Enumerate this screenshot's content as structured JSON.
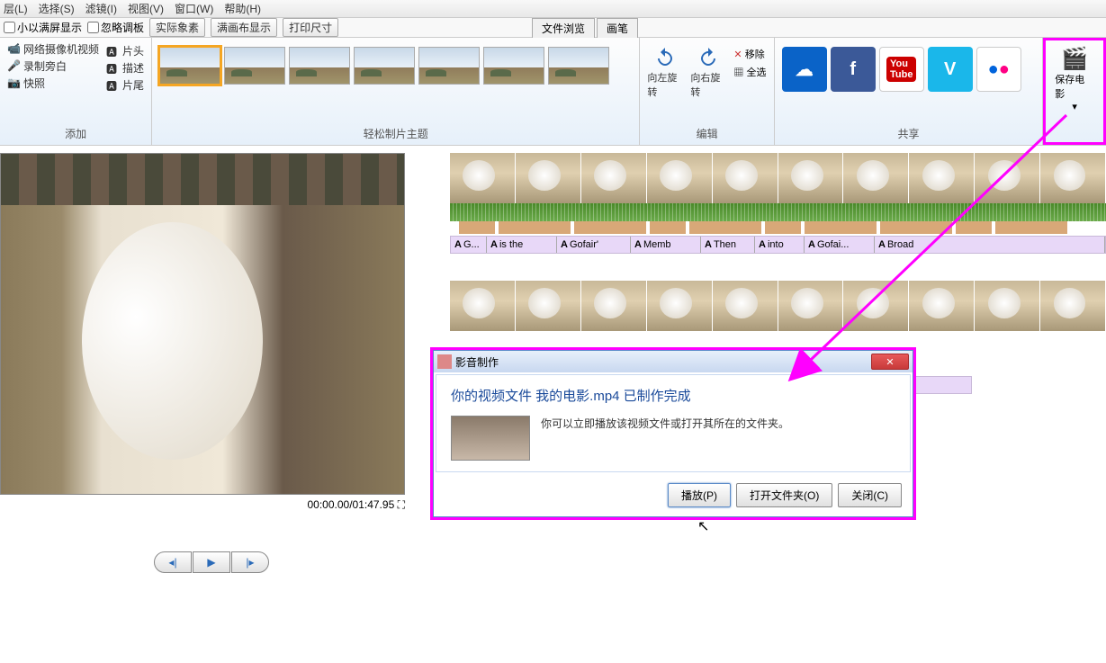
{
  "menu": [
    "层(L)",
    "选择(S)",
    "滤镜(I)",
    "视图(V)",
    "窗口(W)",
    "帮助(H)"
  ],
  "toolbar": {
    "checkbox1": "小以满屏显示",
    "checkbox2": "忽略调板",
    "btn1": "实际象素",
    "btn2": "满画布显示",
    "btn3": "打印尺寸",
    "tab1": "文件浏览",
    "tab2": "画笔"
  },
  "ribbon": {
    "add": {
      "label": "添加",
      "items": [
        "网络摄像机视频",
        "录制旁白",
        "快照",
        "片头",
        "描述",
        "片尾"
      ]
    },
    "themes": {
      "label": "轻松制片主题"
    },
    "edit": {
      "label": "编辑",
      "rotLeft": "向左旋转",
      "rotRight": "向右旋转",
      "remove": "移除",
      "selectAll": "全选"
    },
    "share": {
      "label": "共享"
    },
    "save": {
      "label": "保存电影"
    }
  },
  "preview": {
    "time": "00:00.00/01:47.95"
  },
  "textClips": [
    "G...",
    "is the",
    "Gofair'",
    "Memb",
    "Then",
    "into",
    "Gofai...",
    "Broad"
  ],
  "dialog": {
    "title": "影音制作",
    "heading": "你的视频文件 我的电影.mp4 已制作完成",
    "body": "你可以立即播放该视频文件或打开其所在的文件夹。",
    "btnPlay": "播放(P)",
    "btnOpen": "打开文件夹(O)",
    "btnClose": "关闭(C)"
  }
}
